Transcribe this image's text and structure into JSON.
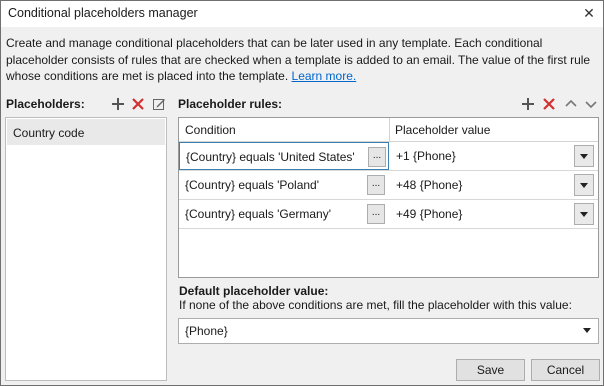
{
  "window": {
    "title": "Conditional placeholders manager"
  },
  "description": {
    "lines": [
      "Create and manage conditional placeholders that can be later used in any template. Each conditional",
      "placeholder consists of rules that are checked when a template is added to an email. The value of the first rule"
    ],
    "last_line": "whose conditions are met is placed into the template.",
    "link": "Learn more."
  },
  "placeholders": {
    "label": "Placeholders:",
    "items": [
      "Country code"
    ]
  },
  "rules": {
    "label": "Placeholder rules:",
    "columns": {
      "condition": "Condition",
      "value": "Placeholder value"
    },
    "rows": [
      {
        "condition": "{Country} equals 'United States'",
        "value": "+1 {Phone}"
      },
      {
        "condition": "{Country} equals 'Poland'",
        "value": "+48 {Phone}"
      },
      {
        "condition": "{Country} equals 'Germany'",
        "value": "+49 {Phone}"
      }
    ],
    "ellipsis": "..."
  },
  "default_value": {
    "label": "Default placeholder value:",
    "hint": "If none of the above conditions are met, fill the placeholder with this value:",
    "value": "{Phone}"
  },
  "buttons": {
    "save": "Save",
    "cancel": "Cancel"
  },
  "colors": {
    "add_icon": "#555555",
    "delete_icon": "#d32f2f",
    "link": "#0066cc"
  }
}
